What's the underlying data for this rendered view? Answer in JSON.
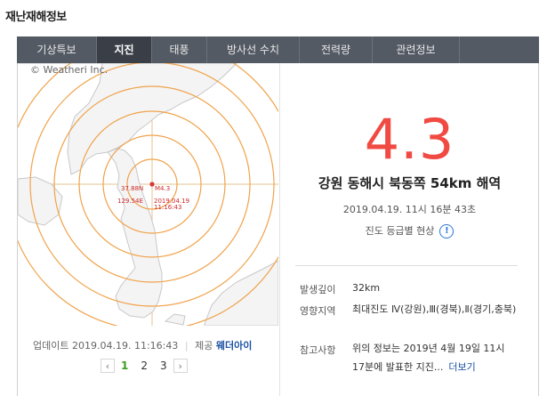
{
  "page_title": "재난재해정보",
  "tabs": [
    {
      "label": "기상특보",
      "active": false
    },
    {
      "label": "지진",
      "active": true
    },
    {
      "label": "태풍",
      "active": false
    },
    {
      "label": "방사선 수치",
      "active": false
    },
    {
      "label": "전력량",
      "active": false
    },
    {
      "label": "관련정보",
      "active": false
    }
  ],
  "map": {
    "copyright": "© Weatheri Inc.",
    "lat_label": "37.88N",
    "lon_label": "129.54E",
    "mag_label": "M4.3",
    "date_label": "2019.04.19",
    "time_label": "11:16:43",
    "epicenter_color": "#d93636",
    "ring_color": "#f0a24a"
  },
  "update": {
    "label": "업데이트",
    "datetime": "2019.04.19. 11:16:43",
    "provider_label": "제공",
    "provider": "웨더아이"
  },
  "pagination": {
    "prev": "‹",
    "pages": [
      "1",
      "2",
      "3"
    ],
    "active": "1",
    "next": "›"
  },
  "quake": {
    "magnitude": "4.3",
    "location": "강원 동해시 북동쪽 54km 해역",
    "datetime": "2019.04.19. 11시 16분 43초",
    "intensity_link": "진도 등급별 현상",
    "accent_color": "#f04a42"
  },
  "details": {
    "depth_label": "발생깊이",
    "depth": "32km",
    "region_label": "영향지역",
    "region": "최대진도 Ⅳ(강원),Ⅲ(경북),Ⅱ(경기,충북)",
    "note_label": "참고사항",
    "note": "위의 정보는 2019년 4월 19일 11시 17분에 발표한 지진...",
    "more": "더보기"
  }
}
